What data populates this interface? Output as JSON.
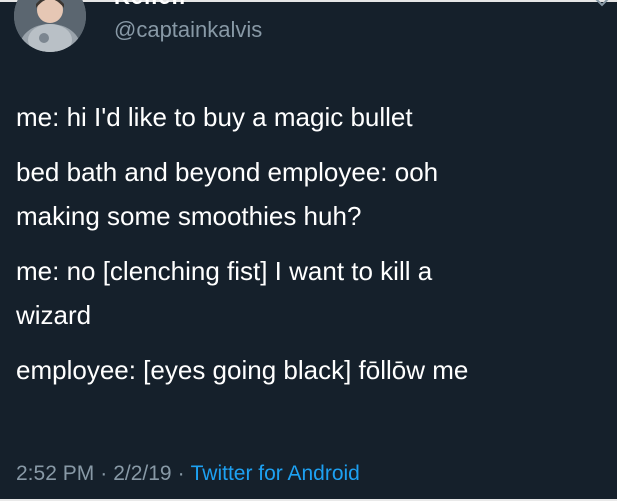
{
  "author": {
    "display_name": "Kellen",
    "handle": "@captainkalvis"
  },
  "tweet": {
    "lines": [
      "me: hi I'd like to buy a magic bullet",
      "bed bath and beyond employee: ooh",
      "making some smoothies huh?",
      "me: no [clenching fist] I want to kill a",
      "wizard",
      "employee: [eyes going black] fōllōw me"
    ]
  },
  "meta": {
    "time": "2:52 PM",
    "separator": "·",
    "date": "2/2/19",
    "source": "Twitter for Android"
  },
  "colors": {
    "background": "#15202b",
    "text": "#ffffff",
    "secondary": "#8899a6",
    "accent": "#1da1f2"
  }
}
